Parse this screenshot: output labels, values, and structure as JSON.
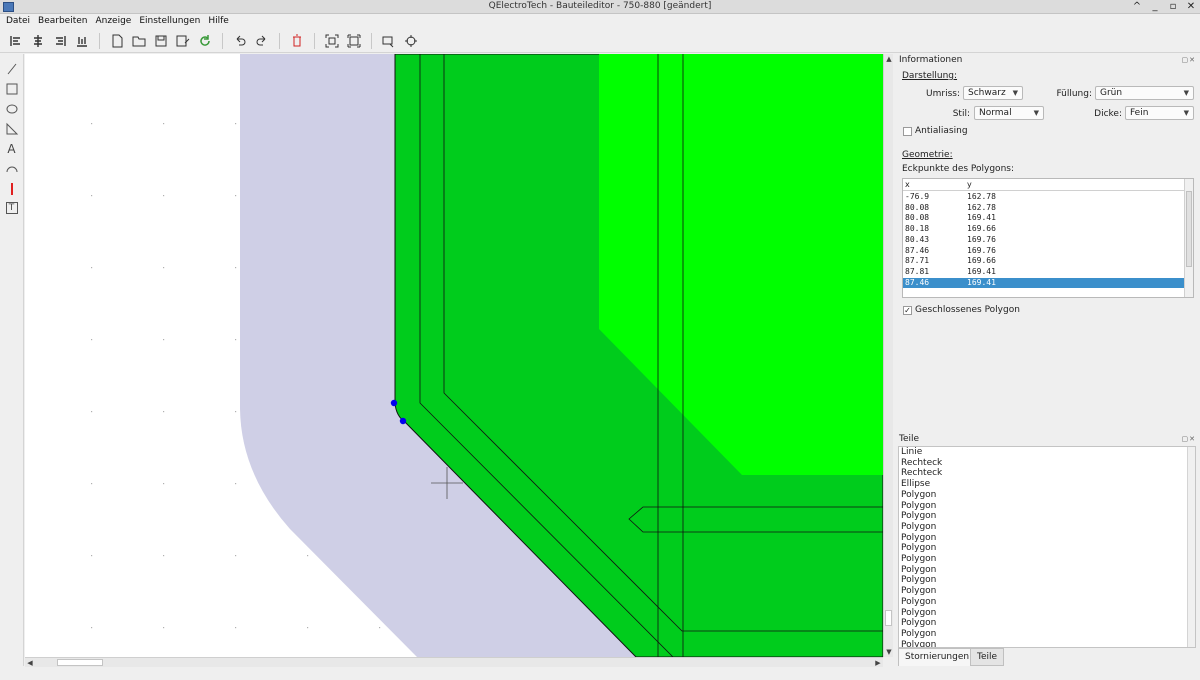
{
  "window": {
    "title": "QElectroTech - Bauteileditor - 750-880 [geändert]",
    "buttons": [
      "^",
      "_",
      "▫",
      "✕"
    ]
  },
  "menu": [
    "Datei",
    "Bearbeiten",
    "Anzeige",
    "Einstellungen",
    "Hilfe"
  ],
  "toolbar": [
    "align-left-icon",
    "align-center-icon",
    "align-right-icon",
    "align-bottom-icon",
    "new-icon",
    "open-icon",
    "save-icon",
    "save-as-icon",
    "reload-icon",
    "undo-icon",
    "redo-icon",
    "delete-icon",
    "zoom-fit-icon",
    "zoom-reset-icon",
    "edit-info-icon",
    "settings-icon"
  ],
  "palette": [
    "line-tool-icon",
    "rectangle-tool-icon",
    "ellipse-tool-icon",
    "polygon-tool-icon",
    "text-tool-icon",
    "arc-tool-icon",
    "terminal-tool-icon",
    "textfield-tool-icon"
  ],
  "palette_glyphs": {
    "text_tool": "A",
    "textfield_tool": "T"
  },
  "colors": {
    "canvas": "#ffffff",
    "outline_fill": "#cfcfe6",
    "dark_green": "#00cc1c",
    "bright_green": "#00ff00",
    "selection": "#3b8fcb",
    "vertex": "#0000ee"
  },
  "info_panel": {
    "title": "Informationen",
    "darstellung_label": "Darstellung:",
    "umriss_label": "Umriss:",
    "umriss_value": "Schwarz",
    "fuellung_label": "Füllung:",
    "fuellung_value": "Grün",
    "stil_label": "Stil:",
    "stil_value": "Normal",
    "dicke_label": "Dicke:",
    "dicke_value": "Fein",
    "antialiasing_label": "Antialiasing",
    "antialiasing_checked": false,
    "geometrie_label": "Geometrie:",
    "eckpunkte_label": "Eckpunkte des Polygons:",
    "table_headers": [
      "x",
      "y"
    ],
    "points": [
      {
        "x": "-76.9",
        "y": "162.78"
      },
      {
        "x": "80.08",
        "y": "162.78"
      },
      {
        "x": "80.08",
        "y": "169.41"
      },
      {
        "x": "80.18",
        "y": "169.66"
      },
      {
        "x": "80.43",
        "y": "169.76"
      },
      {
        "x": "87.46",
        "y": "169.76"
      },
      {
        "x": "87.71",
        "y": "169.66"
      },
      {
        "x": "87.81",
        "y": "169.41"
      },
      {
        "x": "87.46",
        "y": "169.41"
      }
    ],
    "selected_point_index": 8,
    "geschlossen_label": "Geschlossenes Polygon",
    "geschlossen_checked": true
  },
  "parts_panel": {
    "title": "Teile",
    "items": [
      "Linie",
      "Rechteck",
      "Rechteck",
      "Ellipse",
      "Polygon",
      "Polygon",
      "Polygon",
      "Polygon",
      "Polygon",
      "Polygon",
      "Polygon",
      "Polygon",
      "Polygon",
      "Polygon",
      "Polygon",
      "Polygon",
      "Polygon",
      "Polygon",
      "Polygon"
    ]
  },
  "tabs": [
    {
      "label": "Stornierungen",
      "active": true
    },
    {
      "label": "Teile",
      "active": false
    }
  ],
  "dock_buttons": "▢✕",
  "scroll_arrows": {
    "up": "▲",
    "down": "▼",
    "left": "◀",
    "right": "▶"
  }
}
